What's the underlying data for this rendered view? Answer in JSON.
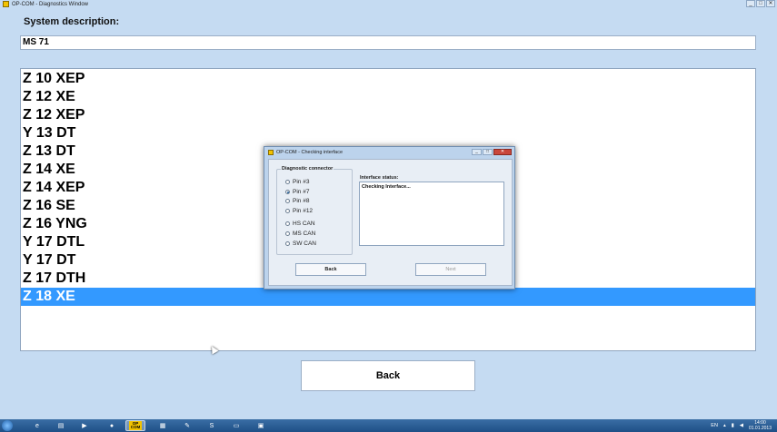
{
  "window": {
    "title": "OP-COM - Diagnostics Window",
    "controls": [
      "_",
      "□",
      "✕"
    ]
  },
  "system_description": {
    "label": "System description:",
    "value": "MS 71"
  },
  "engines": {
    "items": [
      "Z 10 XEP",
      "Z 12 XE",
      "Z 12 XEP",
      "Y 13 DT",
      "Z 13 DT",
      "Z 14 XE",
      "Z 14 XEP",
      "Z 16 SE",
      "Z 16 YNG",
      "Y 17 DTL",
      "Y 17 DT",
      "Z 17 DTH",
      "Z 18 XE"
    ],
    "selected": "Z 18 XE"
  },
  "main_back_label": "Back",
  "dialog": {
    "title": "OP-COM - Checking interface",
    "controls": [
      "_",
      "□",
      "✕"
    ],
    "connector_group_title": "Diagnostic connector",
    "pins": [
      "Pin #3",
      "Pin #7",
      "Pin #8",
      "Pin #12"
    ],
    "selected_pin": "Pin #7",
    "buses": [
      "HS CAN",
      "MS CAN",
      "SW CAN"
    ],
    "status_label": "Interface status:",
    "status_text": "Checking Interface...",
    "back_label": "Back",
    "next_label": "Next"
  },
  "taskbar": {
    "app_label": "OP COM",
    "tray_lang": "EN",
    "clock_time": "14:00",
    "clock_date": "01.01.2013"
  }
}
